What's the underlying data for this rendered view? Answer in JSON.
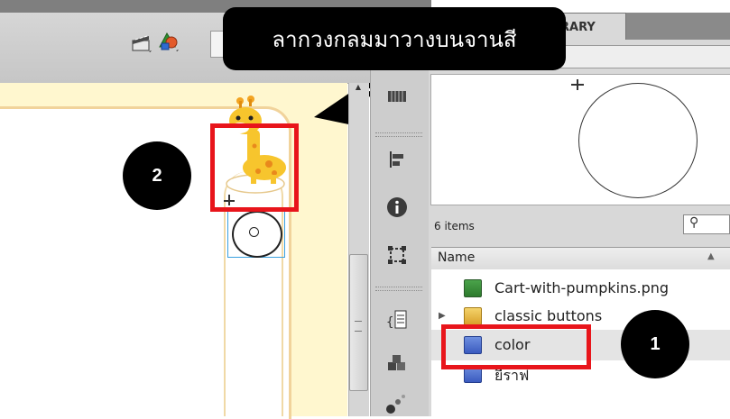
{
  "window": {
    "library_tab_label": "RARY"
  },
  "library": {
    "items_count": "6 items",
    "search_icon": "⚲",
    "column_name": "Name",
    "items": [
      {
        "label": "Cart-with-pumpkins.png",
        "icon": "bitmap-icon",
        "expandable": false
      },
      {
        "label": "classic buttons",
        "icon": "folder-icon",
        "expandable": true
      },
      {
        "label": "color",
        "icon": "symbol-icon",
        "expandable": false,
        "selected": true
      },
      {
        "label": "ยีราฟ",
        "icon": "symbol-icon",
        "expandable": false
      }
    ]
  },
  "annotations": {
    "callout_text": "ลากวงกลมมาวางบนจานสี",
    "badge_1": "1",
    "badge_2": "2",
    "highlight_color": "#e8151b"
  },
  "dock_icons": [
    "grid-icon",
    "align-icon",
    "info-icon",
    "transform-icon",
    "code-snippets-icon",
    "components-icon",
    "motion-presets-icon"
  ]
}
